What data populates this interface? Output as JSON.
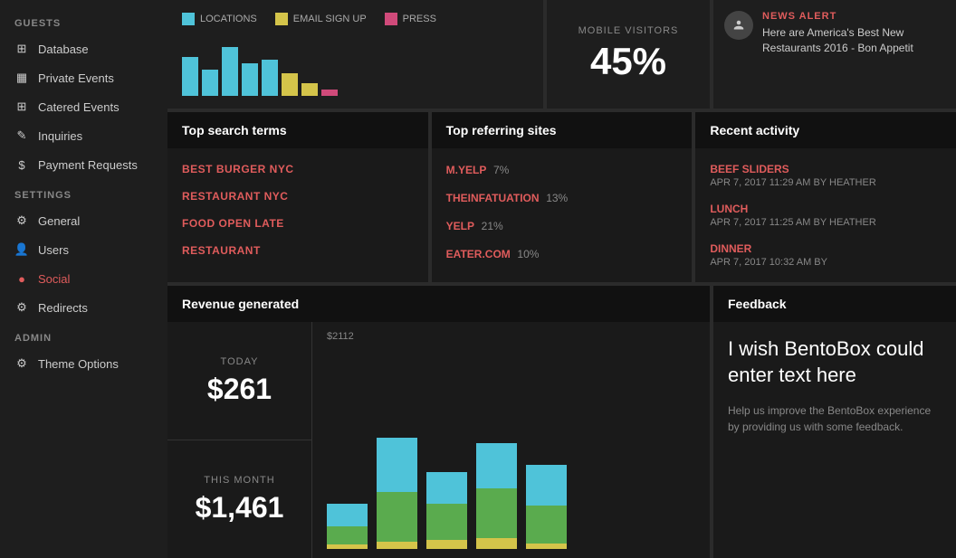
{
  "sidebar": {
    "guests_label": "GUESTS",
    "settings_label": "SETTINGS",
    "admin_label": "ADMIN",
    "items": {
      "database": "Database",
      "private_events": "Private Events",
      "catered_events": "Catered Events",
      "inquiries": "Inquiries",
      "payment_requests": "Payment Requests",
      "general": "General",
      "users": "Users",
      "social": "Social",
      "redirects": "Redirects",
      "theme_options": "Theme Options"
    }
  },
  "chart_legend": {
    "locations": "LOCATIONS",
    "email_signup": "EMAIL SIGN UP",
    "press": "PRESS",
    "locations_color": "#4fc3d9",
    "email_signup_color": "#d4c44a",
    "press_color": "#d04a7a"
  },
  "mobile_visitors": {
    "label": "MOBILE VISITORS",
    "value": "45%"
  },
  "news": {
    "alert_label": "NEWS ALERT",
    "text": "Here are America's Best New Restaurants 2016 - Bon Appetit"
  },
  "top_search_terms": {
    "header": "Top search terms",
    "items": [
      "BEST BURGER NYC",
      "RESTAURANT NYC",
      "FOOD OPEN LATE",
      "RESTAURANT"
    ]
  },
  "top_referring_sites": {
    "header": "Top referring sites",
    "items": [
      {
        "name": "M.YELP",
        "pct": "7%"
      },
      {
        "name": "THEINFATUATION",
        "pct": "13%"
      },
      {
        "name": "YELP",
        "pct": "21%"
      },
      {
        "name": "EATER.COM",
        "pct": "10%"
      }
    ]
  },
  "recent_activity": {
    "header": "Recent activity",
    "items": [
      {
        "name": "BEEF SLIDERS",
        "date": "APR 7, 2017 11:29 AM BY HEATHER"
      },
      {
        "name": "LUNCH",
        "date": "APR 7, 2017 11:25 AM BY HEATHER"
      },
      {
        "name": "DINNER",
        "date": "APR 7, 2017 10:32 AM BY"
      }
    ]
  },
  "revenue": {
    "header": "Revenue generated",
    "today_label": "TODAY",
    "today_value": "$261",
    "month_label": "THIS MONTH",
    "month_value": "$1,461",
    "max_label": "$2112",
    "bars": [
      {
        "cyan": 25,
        "green": 20,
        "yellow": 5
      },
      {
        "cyan": 50,
        "green": 45,
        "yellow": 8
      },
      {
        "cyan": 30,
        "green": 35,
        "yellow": 10
      },
      {
        "cyan": 45,
        "green": 50,
        "yellow": 12
      },
      {
        "cyan": 40,
        "green": 38,
        "yellow": 6
      }
    ],
    "bar_colors": {
      "cyan": "#4fc3d9",
      "green": "#5aab4e",
      "yellow": "#d4c44a"
    }
  },
  "feedback": {
    "header": "Feedback",
    "heading": "I wish BentoBox could enter text here",
    "description": "Help us improve the BentoBox experience by providing us with some feedback."
  }
}
